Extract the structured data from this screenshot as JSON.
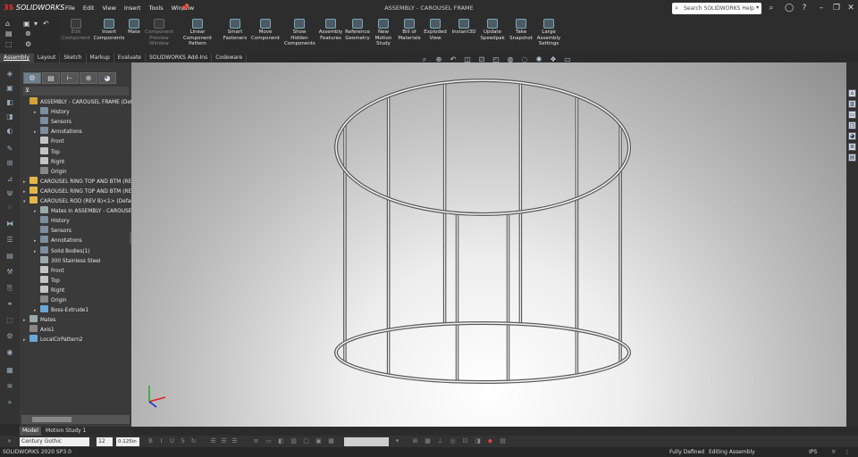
{
  "app": {
    "logo_brand": "3S",
    "logo_text": "SOLIDWORKS",
    "document_title": "ASSEMBLY - CAROUSEL FRAME"
  },
  "menu": [
    "File",
    "Edit",
    "View",
    "Insert",
    "Tools",
    "Window"
  ],
  "search": {
    "placeholder": "Search SOLIDWORKS Help"
  },
  "ribbon": [
    {
      "label": "Edit Component",
      "enabled": false
    },
    {
      "label": "Insert Components",
      "enabled": true
    },
    {
      "label": "Mate",
      "enabled": true
    },
    {
      "label": "Component Preview Window",
      "enabled": false
    },
    {
      "label": "Linear Component Pattern",
      "enabled": true
    },
    {
      "label": "Smart Fasteners",
      "enabled": true
    },
    {
      "label": "Move Component",
      "enabled": true
    },
    {
      "label": "Show Hidden Components",
      "enabled": true
    },
    {
      "label": "Assembly Features",
      "enabled": true
    },
    {
      "label": "Reference Geometry",
      "enabled": true
    },
    {
      "label": "New Motion Study",
      "enabled": true
    },
    {
      "label": "Bill of Materials",
      "enabled": true
    },
    {
      "label": "Exploded View",
      "enabled": true
    },
    {
      "label": "Instant3D",
      "enabled": true
    },
    {
      "label": "Update Speedpak",
      "enabled": true
    },
    {
      "label": "Take Snapshot",
      "enabled": true
    },
    {
      "label": "Large Assembly Settings",
      "enabled": true
    }
  ],
  "tabs": [
    "Assembly",
    "Layout",
    "Sketch",
    "Markup",
    "Evaluate",
    "SOLIDWORKS Add-Ins",
    "Codeware"
  ],
  "active_tab": "Assembly",
  "tree": [
    {
      "label": "ASSEMBLY - CAROUSEL FRAME  (Default<Display State-1>)",
      "icon": "asm",
      "depth": 0,
      "arrow": ""
    },
    {
      "label": "History",
      "icon": "fld",
      "depth": 1,
      "arrow": "▸"
    },
    {
      "label": "Sensors",
      "icon": "fld",
      "depth": 1,
      "arrow": ""
    },
    {
      "label": "Annotations",
      "icon": "fld",
      "depth": 1,
      "arrow": "▸"
    },
    {
      "label": "Front",
      "icon": "pln",
      "depth": 1,
      "arrow": ""
    },
    {
      "label": "Top",
      "icon": "pln",
      "depth": 1,
      "arrow": ""
    },
    {
      "label": "Right",
      "icon": "pln",
      "depth": 1,
      "arrow": ""
    },
    {
      "label": "Origin",
      "icon": "org",
      "depth": 1,
      "arrow": ""
    },
    {
      "label": "CAROUSEL RING TOP AND BTM  (REV B)<1>",
      "icon": "part",
      "depth": 0,
      "arrow": "▸"
    },
    {
      "label": "CAROUSEL RING TOP AND BTM  (REV B)<2>",
      "icon": "part",
      "depth": 0,
      "arrow": "▸"
    },
    {
      "label": "CAROUSEL ROD (REV B)<1> (Default)",
      "icon": "part",
      "depth": 0,
      "arrow": "▾"
    },
    {
      "label": "Mates in ASSEMBLY - CAROUSEL FRAME",
      "icon": "mat",
      "depth": 1,
      "arrow": "▸"
    },
    {
      "label": "History",
      "icon": "fld",
      "depth": 1,
      "arrow": ""
    },
    {
      "label": "Sensors",
      "icon": "fld",
      "depth": 1,
      "arrow": ""
    },
    {
      "label": "Annotations",
      "icon": "fld",
      "depth": 1,
      "arrow": "▸"
    },
    {
      "label": "Solid Bodies(1)",
      "icon": "fld",
      "depth": 1,
      "arrow": "▸"
    },
    {
      "label": "300 Stainless Steel",
      "icon": "mat",
      "depth": 1,
      "arrow": ""
    },
    {
      "label": "Front",
      "icon": "pln",
      "depth": 1,
      "arrow": ""
    },
    {
      "label": "Top",
      "icon": "pln",
      "depth": 1,
      "arrow": ""
    },
    {
      "label": "Right",
      "icon": "pln",
      "depth": 1,
      "arrow": ""
    },
    {
      "label": "Origin",
      "icon": "org",
      "depth": 1,
      "arrow": ""
    },
    {
      "label": "Boss-Extrude1",
      "icon": "feat",
      "depth": 1,
      "arrow": "▸"
    },
    {
      "label": "Mates",
      "icon": "mat",
      "depth": 0,
      "arrow": "▸"
    },
    {
      "label": "Axis1",
      "icon": "org",
      "depth": 0,
      "arrow": ""
    },
    {
      "label": "LocalCirPattern2",
      "icon": "feat",
      "depth": 0,
      "arrow": "▸"
    }
  ],
  "model_tabs": [
    "Model",
    "Motion Study 1"
  ],
  "active_model_tab": "Model",
  "format": {
    "font": "Century Gothic",
    "size": "12",
    "height": "0.125in"
  },
  "status": {
    "version": "SOLIDWORKS 2020 SP3.0",
    "state": "Fully Defined",
    "mode": "Editing Assembly",
    "units": "IPS"
  },
  "colors": {
    "background": "#2b2b2b",
    "panel": "#3a3a3a",
    "accent": "#3a7ec2",
    "model_stroke": "#555555"
  },
  "icons": {
    "window": [
      "user-icon",
      "help-icon",
      "minimize-icon",
      "restore-icon",
      "close-icon"
    ],
    "heads_up": [
      "zoom-to-fit-icon",
      "zoom-area-icon",
      "previous-view-icon",
      "section-view-icon",
      "dynamic-annotation-icon",
      "view-orientation-icon",
      "display-style-icon",
      "hide-show-icon",
      "edit-appearance-icon",
      "apply-scene-icon",
      "view-settings-icon"
    ],
    "right": [
      "home-icon",
      "design-library-icon",
      "file-explorer-icon",
      "view-palette-icon",
      "appearances-icon",
      "custom-properties-icon"
    ]
  }
}
